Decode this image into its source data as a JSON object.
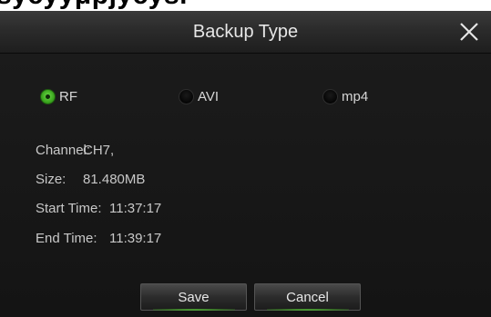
{
  "background_strip": {
    "text": "sycyyμpjycysr"
  },
  "dialog": {
    "title": "Backup Type",
    "close_icon": "close-icon"
  },
  "backup_type": {
    "options": [
      {
        "label": "RF",
        "selected": true
      },
      {
        "label": "AVI",
        "selected": false
      },
      {
        "label": "mp4",
        "selected": false
      }
    ]
  },
  "info": {
    "channel_label": "Channel:",
    "channel_value": "CH7,",
    "size_label": "Size:",
    "size_value": "81.480MB",
    "start_label": "Start Time:",
    "start_value": "11:37:17",
    "end_label": "End Time:",
    "end_value": "11:39:17"
  },
  "buttons": {
    "save_label": "Save",
    "cancel_label": "Cancel"
  },
  "colors": {
    "accent": "#3aa51e",
    "dialog_bg": "#181818",
    "title_bar": "#2b2b2b"
  }
}
